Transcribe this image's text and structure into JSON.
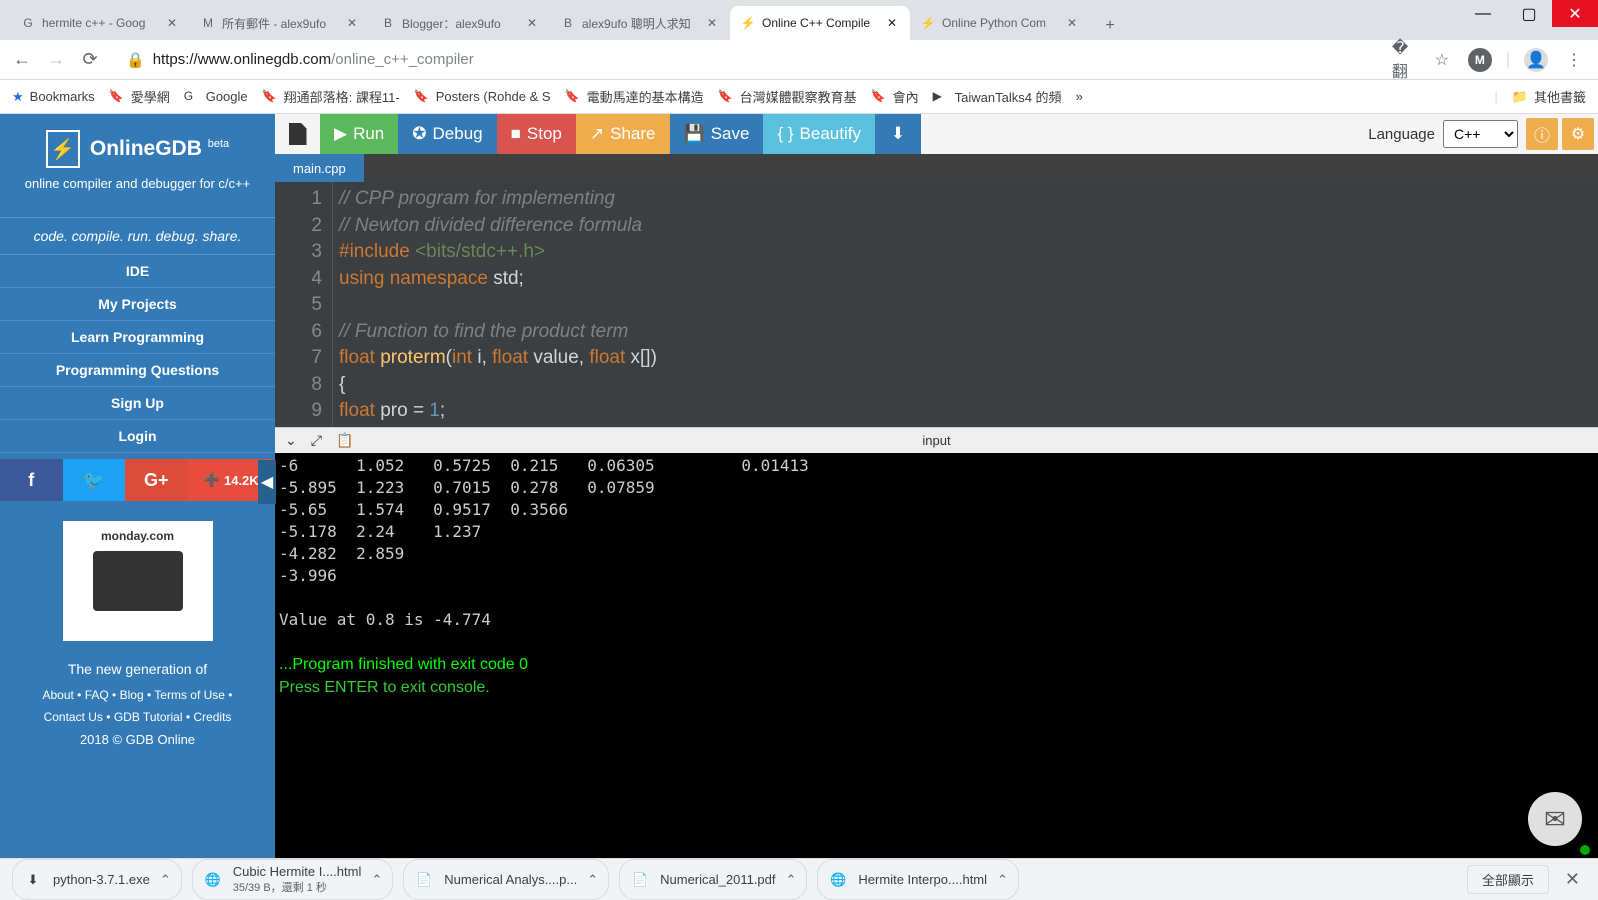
{
  "browser": {
    "tabs": [
      {
        "favicon": "G",
        "title": "hermite c++ - Goog"
      },
      {
        "favicon": "M",
        "title": "所有郵件 - alex9ufo"
      },
      {
        "favicon": "B",
        "title": "Blogger：alex9ufo"
      },
      {
        "favicon": "B",
        "title": "alex9ufo 聰明人求知"
      },
      {
        "favicon": "⚡",
        "title": "Online C++ Compile",
        "active": true
      },
      {
        "favicon": "⚡",
        "title": "Online Python Com"
      }
    ],
    "url_domain": "https://www.onlinegdb.com",
    "url_path": "/online_c++_compiler"
  },
  "bookmarks": {
    "star": "Bookmarks",
    "items": [
      "愛學網",
      "Google",
      "翔通部落格: 課程11-",
      "Posters (Rohde & S",
      "電動馬達的基本構造",
      "台灣媒體觀察教育基",
      "會內",
      "TaiwanTalks4 的頻"
    ],
    "overflow": "»",
    "other": "其他書籤"
  },
  "sidebar": {
    "brand": "OnlineGDB",
    "brand_sup": "beta",
    "subtitle": "online compiler and debugger for c/c++",
    "tagline": "code. compile. run. debug. share.",
    "menu": [
      "IDE",
      "My Projects",
      "Learn Programming",
      "Programming Questions",
      "Sign Up",
      "Login"
    ],
    "share_count": "14.2K",
    "ad_brand": "monday.com",
    "ad_text": "The new generation of",
    "footer1": [
      "About",
      "FAQ",
      "Blog",
      "Terms of Use"
    ],
    "footer2": [
      "Contact Us",
      "GDB Tutorial",
      "Credits"
    ],
    "copyright": "2018 © GDB Online"
  },
  "toolbar": {
    "run": "Run",
    "debug": "Debug",
    "stop": "Stop",
    "share": "Share",
    "save": "Save",
    "beautify": "Beautify",
    "lang_label": "Language",
    "lang_value": "C++"
  },
  "file_tab": "main.cpp",
  "code_lines": [
    {
      "n": 1,
      "cls": "comment",
      "t": "// CPP program for implementing"
    },
    {
      "n": 2,
      "cls": "comment",
      "t": "// Newton divided difference formula"
    },
    {
      "n": 3,
      "raw": "<span class='keyword'>#include</span> <span class='include'>&lt;bits/stdc++.h&gt;</span>"
    },
    {
      "n": 4,
      "raw": "<span class='keyword'>using</span> <span class='keyword'>namespace</span> std;"
    },
    {
      "n": 5,
      "t": ""
    },
    {
      "n": 6,
      "cls": "comment",
      "t": "// Function to find the product term"
    },
    {
      "n": 7,
      "raw": "<span class='type'>float</span> <span class='func'>proterm</span>(<span class='type'>int</span> i, <span class='type'>float</span> value, <span class='type'>float</span> x[])"
    },
    {
      "n": 8,
      "t": "{"
    },
    {
      "n": 9,
      "raw": " <span class='type'>float</span> pro <span class='op'>=</span> <span class='num'>1</span>;"
    }
  ],
  "console_label": "input",
  "console_output": [
    "-6      1.052   0.5725  0.215   0.06305         0.01413",
    "-5.895  1.223   0.7015  0.278   0.07859",
    "-5.65   1.574   0.9517  0.3566",
    "-5.178  2.24    1.237",
    "-4.282  2.859",
    "-3.996",
    "",
    "Value at 0.8 is -4.774",
    ""
  ],
  "console_finish": "...Program finished with exit code 0",
  "console_exit": "Press ENTER to exit console.",
  "downloads": {
    "items": [
      {
        "icon": "⬇",
        "name": "python-3.7.1.exe"
      },
      {
        "icon": "🌐",
        "name": "Cubic Hermite I....html",
        "sub": "35/39 B，還剩 1 秒"
      },
      {
        "icon": "📄",
        "name": "Numerical Analys....p..."
      },
      {
        "icon": "📄",
        "name": "Numerical_2011.pdf"
      },
      {
        "icon": "🌐",
        "name": "Hermite Interpo....html"
      }
    ],
    "showall": "全部顯示"
  }
}
